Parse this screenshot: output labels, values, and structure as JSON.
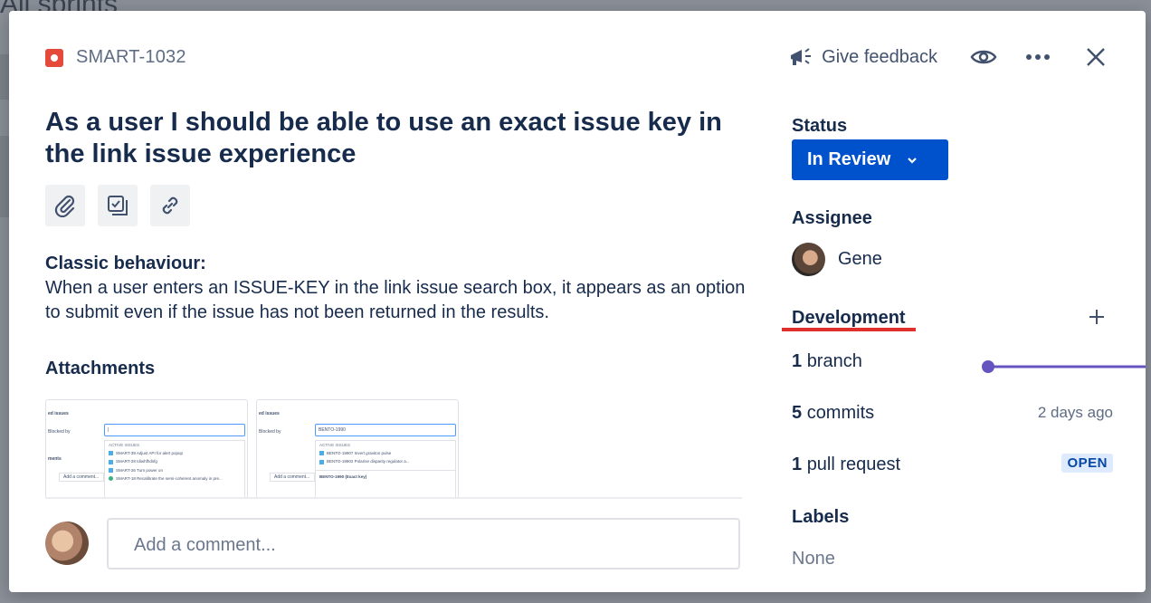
{
  "background": {
    "title": "All sprints"
  },
  "header": {
    "issue_key": "SMART-1032",
    "feedback_label": "Give feedback"
  },
  "issue": {
    "summary": "As a user I should be able to use an exact issue key in the link issue experience",
    "description_heading": "Classic behaviour:",
    "description_body": "When a user enters an ISSUE-KEY in the link issue search box, it appears as an option to submit even if the issue has not been returned in the results.",
    "attachments_heading": "Attachments",
    "attachments": [
      {
        "title": "ed issues",
        "select": "Blocked by",
        "input": "|",
        "comments": "ments",
        "add_comment": "Add a comment...",
        "section": "ACTIVE ISSUES",
        "items": [
          "SMART-39 Adjust API for alert popup",
          "SMART-28 Idiwhfhdsfg",
          "SMART-26 Turn power on",
          "SMART-18 Recalibrate the semi-coherent anomaly in pre..."
        ]
      },
      {
        "title": "ed issues",
        "select": "Blocked by",
        "input": "BENTO-1990",
        "comments": "",
        "add_comment": "Add a comment...",
        "section": "ACTIVE ISSUES",
        "items": [
          "BENTO-19907 Invert graviton pulse",
          "BENTO-19902 Polarise disparity regulator a...",
          "BENTO-1990 (Exact key)"
        ]
      }
    ],
    "comment_placeholder": "Add a comment..."
  },
  "sidebar": {
    "status_label": "Status",
    "status_value": "In Review",
    "assignee_label": "Assignee",
    "assignee_name": "Gene",
    "development_label": "Development",
    "development": {
      "branch_count": "1",
      "branch_label": "branch",
      "commit_count": "5",
      "commit_label": "commits",
      "commit_time": "2 days ago",
      "pr_count": "1",
      "pr_label": "pull request",
      "pr_status": "OPEN"
    },
    "labels_label": "Labels",
    "labels_value": "None"
  },
  "colors": {
    "primary": "#0052cc",
    "bug": "#e5493a",
    "highlight_underline": "#e0302c",
    "connector": "#6554c0",
    "lozenge_bg": "#deebff"
  },
  "icons": [
    "bug-icon",
    "megaphone-icon",
    "eye-icon",
    "more-icon",
    "close-icon",
    "paperclip-icon",
    "checklist-icon",
    "link-icon",
    "chevron-down-icon",
    "plus-icon"
  ]
}
